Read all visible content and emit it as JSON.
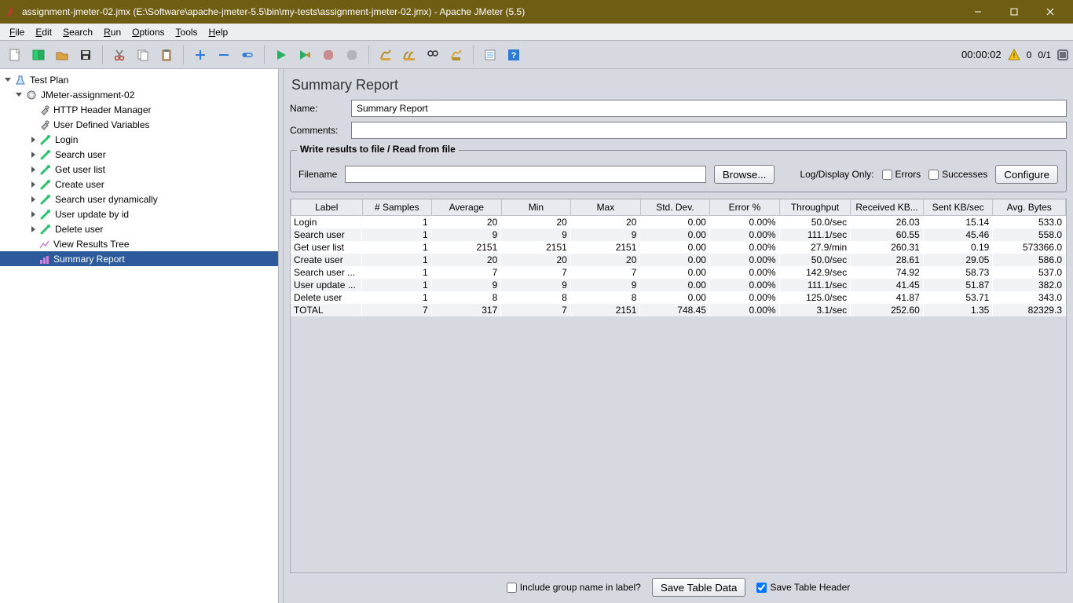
{
  "titlebar": {
    "text": "assignment-jmeter-02.jmx (E:\\Software\\apache-jmeter-5.5\\bin\\my-tests\\assignment-jmeter-02.jmx) - Apache JMeter (5.5)"
  },
  "menubar": [
    "File",
    "Edit",
    "Search",
    "Run",
    "Options",
    "Tools",
    "Help"
  ],
  "status": {
    "time": "00:00:02",
    "warn_count": "0",
    "threads": "0/1"
  },
  "tree": {
    "root": "Test Plan",
    "group": "JMeter-assignment-02",
    "items": [
      "HTTP Header Manager",
      "User Defined Variables",
      "Login",
      "Search user",
      "Get user list",
      "Create user",
      "Search user dynamically",
      "User update by id",
      "Delete user",
      "View Results Tree",
      "Summary Report"
    ]
  },
  "panel": {
    "title": "Summary Report",
    "labels": {
      "name": "Name:",
      "comments": "Comments:",
      "write_results": "Write results to file / Read from file",
      "filename": "Filename",
      "browse": "Browse...",
      "log_only": "Log/Display Only:",
      "errors": "Errors",
      "successes": "Successes",
      "configure": "Configure",
      "include_group": "Include group name in label?",
      "save_table": "Save Table Data",
      "save_header": "Save Table Header"
    },
    "values": {
      "name": "Summary Report",
      "comments": "",
      "filename": "",
      "errors_checked": false,
      "successes_checked": false,
      "include_group_checked": false,
      "save_header_checked": true
    }
  },
  "table": {
    "headers": [
      "Label",
      "# Samples",
      "Average",
      "Min",
      "Max",
      "Std. Dev.",
      "Error %",
      "Throughput",
      "Received KB...",
      "Sent KB/sec",
      "Avg. Bytes"
    ],
    "rows": [
      [
        "Login",
        "1",
        "20",
        "20",
        "20",
        "0.00",
        "0.00%",
        "50.0/sec",
        "26.03",
        "15.14",
        "533.0"
      ],
      [
        "Search user",
        "1",
        "9",
        "9",
        "9",
        "0.00",
        "0.00%",
        "111.1/sec",
        "60.55",
        "45.46",
        "558.0"
      ],
      [
        "Get user list",
        "1",
        "2151",
        "2151",
        "2151",
        "0.00",
        "0.00%",
        "27.9/min",
        "260.31",
        "0.19",
        "573366.0"
      ],
      [
        "Create user",
        "1",
        "20",
        "20",
        "20",
        "0.00",
        "0.00%",
        "50.0/sec",
        "28.61",
        "29.05",
        "586.0"
      ],
      [
        "Search user ...",
        "1",
        "7",
        "7",
        "7",
        "0.00",
        "0.00%",
        "142.9/sec",
        "74.92",
        "58.73",
        "537.0"
      ],
      [
        "User update ...",
        "1",
        "9",
        "9",
        "9",
        "0.00",
        "0.00%",
        "111.1/sec",
        "41.45",
        "51.87",
        "382.0"
      ],
      [
        "Delete user",
        "1",
        "8",
        "8",
        "8",
        "0.00",
        "0.00%",
        "125.0/sec",
        "41.87",
        "53.71",
        "343.0"
      ],
      [
        "TOTAL",
        "7",
        "317",
        "7",
        "2151",
        "748.45",
        "0.00%",
        "3.1/sec",
        "252.60",
        "1.35",
        "82329.3"
      ]
    ]
  }
}
